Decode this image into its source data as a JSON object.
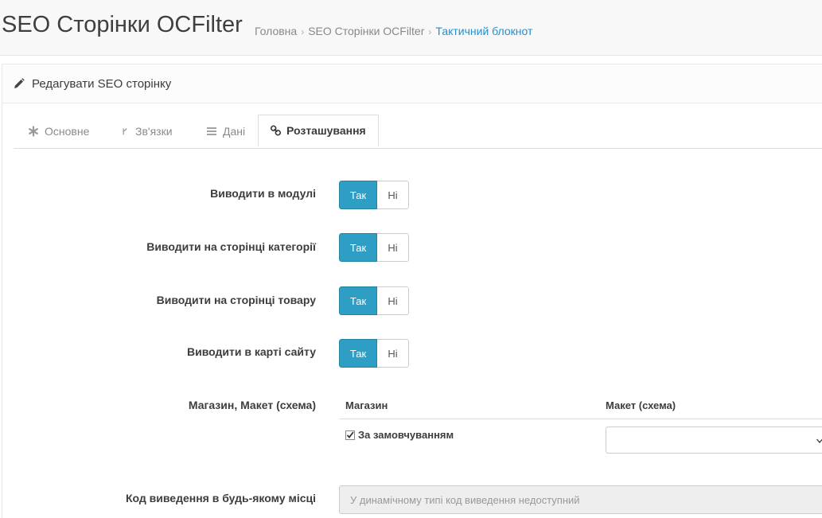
{
  "header": {
    "title": "SEO Сторінки OCFilter",
    "breadcrumb": [
      "Головна",
      "SEO Сторінки OCFilter",
      "Тактичний блокнот"
    ],
    "breadcrumb_separator": "›"
  },
  "panel": {
    "heading": "Редагувати SEO сторінку"
  },
  "tabs": [
    {
      "label": "Основне",
      "icon": "asterisk-icon"
    },
    {
      "label": "Зв'язки",
      "icon": "branch-icon"
    },
    {
      "label": "Дані",
      "icon": "list-icon"
    },
    {
      "label": "Розташування",
      "icon": "link-icon",
      "active": true
    }
  ],
  "form": {
    "toggles": [
      {
        "label": "Виводити в модулі",
        "yes": "Так",
        "no": "Ні",
        "value": "Так"
      },
      {
        "label": "Виводити на сторінці категорії",
        "yes": "Так",
        "no": "Ні",
        "value": "Так"
      },
      {
        "label": "Виводити на сторінці товару",
        "yes": "Так",
        "no": "Ні",
        "value": "Так"
      },
      {
        "label": "Виводити в карті сайту",
        "yes": "Так",
        "no": "Ні",
        "value": "Так"
      }
    ],
    "store_layout": {
      "label": "Магазин, Макет (схема)",
      "col_store": "Магазин",
      "col_layout": "Макет (схема)",
      "store_option": "За замовчуванням",
      "store_checked": true,
      "layout_value": ""
    },
    "code": {
      "label": "Код виведення в будь-якому місці",
      "placeholder": "У динамічному типі код виведення недоступний"
    }
  },
  "colors": {
    "accent": "#2e9ec4",
    "breadcrumb_active": "#1e91cf"
  }
}
